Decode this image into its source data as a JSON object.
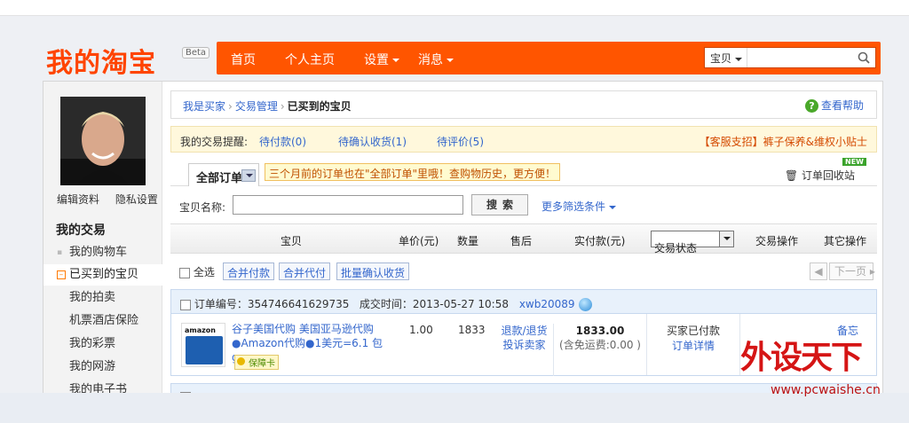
{
  "brand": {
    "logo_text": "我的淘宝",
    "beta_label": "Beta",
    "accent_color": "#ff5500"
  },
  "nav": {
    "items": [
      {
        "label": "首页",
        "has_dropdown": false
      },
      {
        "label": "个人主页",
        "has_dropdown": false
      },
      {
        "label": "设置",
        "has_dropdown": true
      },
      {
        "label": "消息",
        "has_dropdown": true
      }
    ],
    "search": {
      "scope": "宝贝",
      "value": "",
      "icon": "search-icon"
    }
  },
  "sidebar": {
    "profile_links": [
      "编辑资料",
      "隐私设置"
    ],
    "section_title": "我的交易",
    "items": [
      {
        "label": "我的购物车",
        "active": false
      },
      {
        "label": "已买到的宝贝",
        "active": true
      },
      {
        "label": "我的拍卖",
        "active": false
      },
      {
        "label": "机票酒店保险",
        "active": false
      },
      {
        "label": "我的彩票",
        "active": false
      },
      {
        "label": "我的网游",
        "active": false
      },
      {
        "label": "我的电子书",
        "active": false
      }
    ]
  },
  "breadcrumb": {
    "items": [
      "我是买家",
      "交易管理"
    ],
    "current": "已买到的宝贝",
    "help_label": "查看帮助"
  },
  "reminder": {
    "label": "我的交易提醒:",
    "links": [
      "待付款(0)",
      "待确认收货(1)",
      "待评价(5)"
    ],
    "tip": "【客服支招】裤子保养&维权小贴士"
  },
  "tabs": {
    "all_orders": "全部订单",
    "notice": "三个月前的订单也在\"全部订单\"里哦！查购物历史，更方便！",
    "recycle_label": "订单回收站",
    "new_badge": "NEW"
  },
  "search_form": {
    "label": "宝贝名称:",
    "value": "",
    "button": "搜索",
    "more_filters": "更多筛选条件"
  },
  "table_header": {
    "columns": [
      "宝贝",
      "单价(元)",
      "数量",
      "售后",
      "实付款(元)",
      "交易操作",
      "其它操作"
    ],
    "status_filter": "交易状态"
  },
  "batch_actions": {
    "select_all": "全选",
    "buttons": [
      "合并付款",
      "合并代付",
      "批量确认收货"
    ],
    "prev_page": "◀",
    "next_page": "下一页"
  },
  "orders": [
    {
      "order_no_label": "订单编号：",
      "order_no": "354746641629735",
      "time_label": "成交时间：",
      "time": "2013-05-27 10:58",
      "seller": "xwb20089",
      "thumb_brand": "amazon",
      "title": "谷子美国代购 美国亚马逊代购●Amazon代购●1美元=6.1 包guan",
      "guarantee": "保障卡",
      "unit_price": "1.00",
      "quantity": "1833",
      "after_sale": [
        "退款/退货",
        "投诉卖家"
      ],
      "paid": "1833.00",
      "shipping": "(含免运费:0.00 )",
      "status": "买家已付款",
      "detail_link": "订单详情",
      "note_link": "备忘"
    }
  ],
  "watermark": {
    "logo_text": "外设天下",
    "url": "www.pcwaishe.cn"
  }
}
